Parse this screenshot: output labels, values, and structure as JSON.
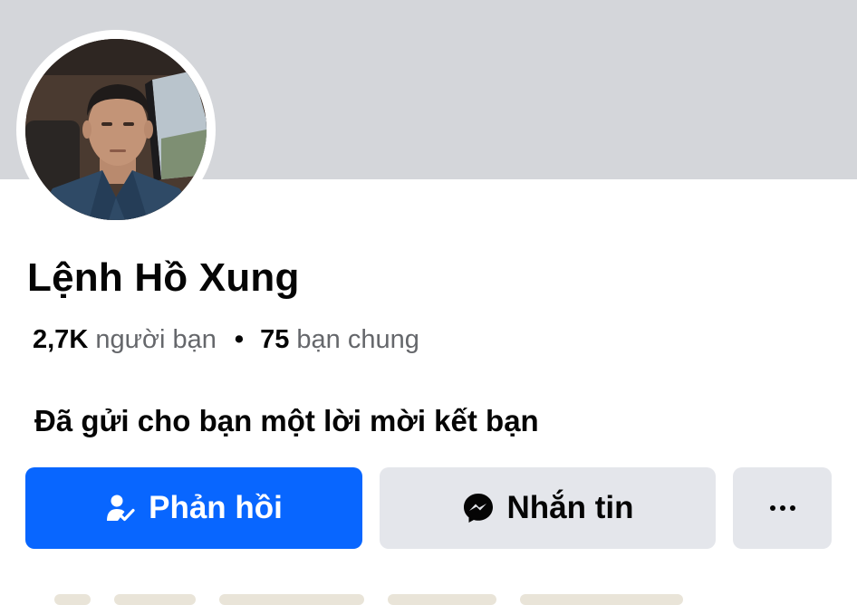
{
  "profile": {
    "name": "Lệnh Hồ Xung",
    "friends_count": "2,7K",
    "friends_label": "người bạn",
    "separator": "•",
    "mutual_count": "75",
    "mutual_label": "bạn chung",
    "request_text": "Đã gửi cho bạn một lời mời kết bạn"
  },
  "actions": {
    "respond_label": "Phản hồi",
    "respond_icon": "person-check-icon",
    "message_label": "Nhắn tin",
    "message_icon": "messenger-icon",
    "more_icon": "more-dots-icon"
  },
  "colors": {
    "primary": "#0866ff",
    "secondary_button": "#e4e6eb",
    "cover": "#d4d6da",
    "text": "#050505",
    "muted_text": "#65676b"
  }
}
